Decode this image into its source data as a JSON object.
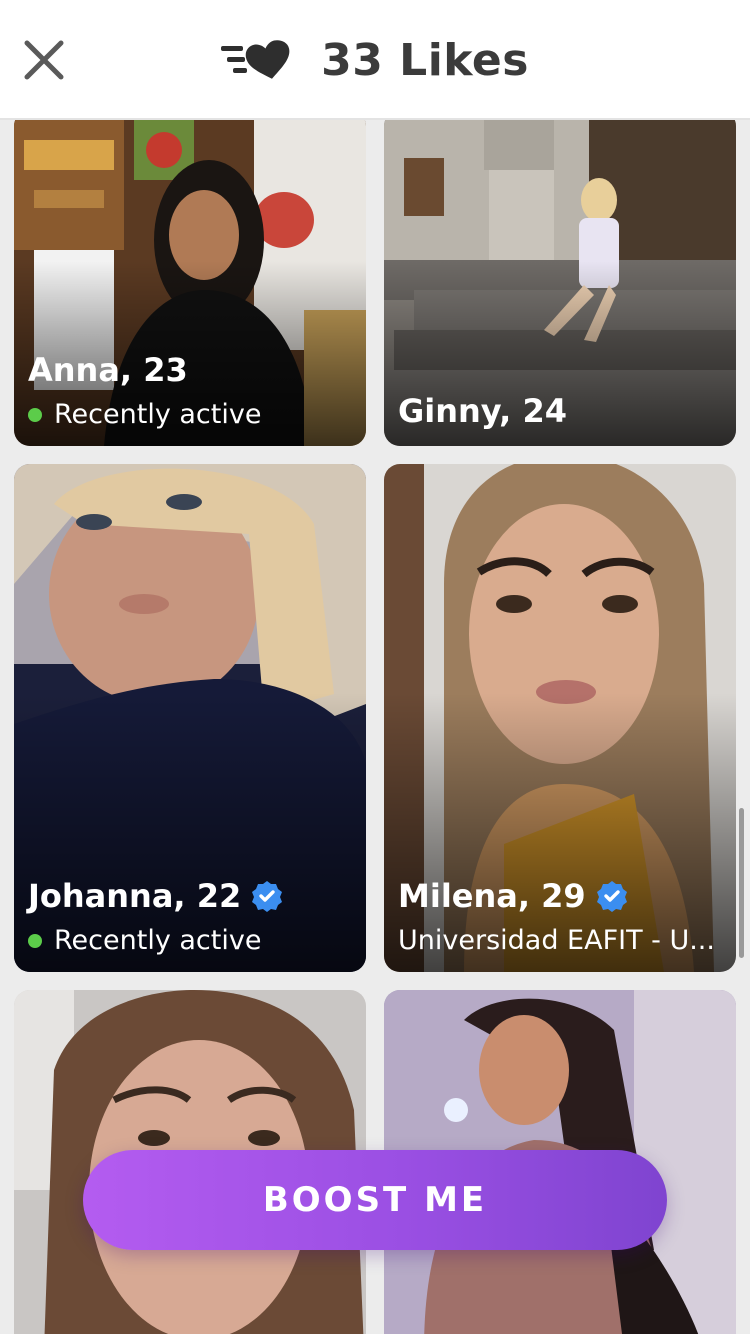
{
  "header": {
    "title": "33 Likes",
    "close_icon": "close-icon",
    "likes_icon": "likes-heart-icon"
  },
  "cards": [
    {
      "name": "Anna, 23",
      "status": "Recently active",
      "verified": false
    },
    {
      "name": "Ginny, 24",
      "status": "",
      "verified": false
    },
    {
      "name": "Johanna, 22",
      "status": "Recently active",
      "verified": true
    },
    {
      "name": "Milena, 29",
      "status": "Universidad EAFIT - U...",
      "verified": true
    },
    {
      "name": "",
      "status": "",
      "verified": false
    },
    {
      "name": "",
      "status": "",
      "verified": false
    }
  ],
  "boost_button": {
    "label": "BOOST ME"
  },
  "colors": {
    "active_dot": "#5ccc4a",
    "verified_badge": "#3b8ef0",
    "boost_start": "#b45cf0",
    "boost_end": "#7f44d0"
  }
}
